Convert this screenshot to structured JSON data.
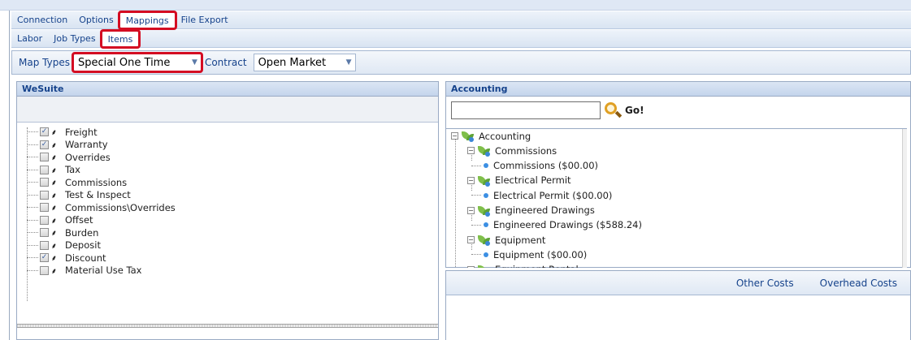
{
  "menu_tabs": [
    "Connection",
    "Options",
    "Mappings",
    "File Export"
  ],
  "sub_tabs": [
    "Labor",
    "Job Types",
    "Items"
  ],
  "filters": {
    "map_types_label": "Map Types",
    "map_types_value": "Special One Time",
    "contract_label": "Contract",
    "contract_value": "Open Market"
  },
  "wesuite": {
    "title": "WeSuite",
    "items": [
      {
        "label": "Freight",
        "checked": true
      },
      {
        "label": "Warranty",
        "checked": true
      },
      {
        "label": "Overrides",
        "checked": false
      },
      {
        "label": "Tax",
        "checked": false
      },
      {
        "label": "Commissions",
        "checked": false
      },
      {
        "label": "Test & Inspect",
        "checked": false
      },
      {
        "label": "Commissions\\Overrides",
        "checked": false
      },
      {
        "label": "Offset",
        "checked": false
      },
      {
        "label": "Burden",
        "checked": false
      },
      {
        "label": "Deposit",
        "checked": false
      },
      {
        "label": "Discount",
        "checked": true
      },
      {
        "label": "Material Use Tax",
        "checked": false
      }
    ]
  },
  "accounting": {
    "title": "Accounting",
    "go_label": "Go!",
    "root": "Accounting",
    "groups": [
      {
        "name": "Commissions",
        "child": "Commissions ($00.00)"
      },
      {
        "name": "Electrical Permit",
        "child": "Electrical Permit ($00.00)"
      },
      {
        "name": "Engineered Drawings",
        "child": "Engineered Drawings ($588.24)"
      },
      {
        "name": "Equipment",
        "child": "Equipment ($00.00)"
      },
      {
        "name": "Equipment Rental",
        "child": ""
      }
    ]
  },
  "cost_tabs": [
    "Other Costs",
    "Overhead Costs"
  ]
}
